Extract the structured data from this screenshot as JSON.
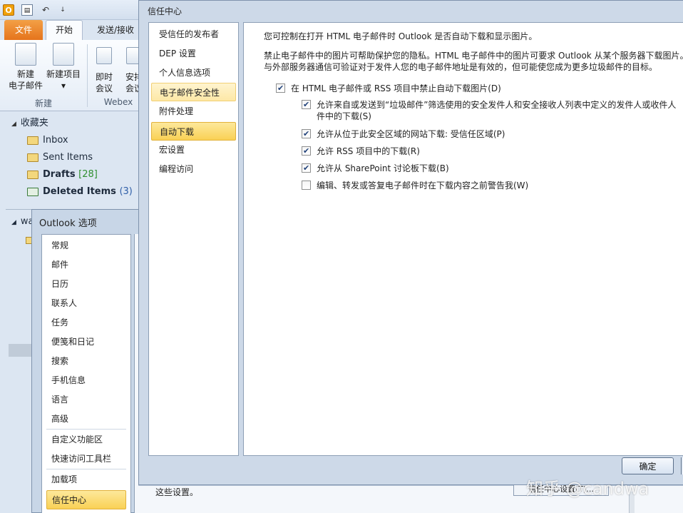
{
  "outlook": {
    "qat": {
      "logo_letter": "O",
      "dropdown_glyph": "↓"
    },
    "tabs": {
      "file": "文件",
      "home": "开始",
      "send_receive": "发送/接收"
    },
    "ribbon": {
      "new_email": [
        "新建",
        "电子邮件"
      ],
      "new_item": [
        "新建项目",
        "▾"
      ],
      "instant_meeting": [
        "即时",
        "会议"
      ],
      "arrange_meeting": [
        "安排",
        "会议"
      ],
      "group_new": "新建",
      "group_webex": "Webex"
    },
    "nav": {
      "favorites": "收藏夹",
      "inbox": "Inbox",
      "sent": "Sent Items",
      "drafts": "Drafts",
      "drafts_count": "[28]",
      "deleted": "Deleted Items",
      "deleted_count": "(3)",
      "account": "wa"
    }
  },
  "options_dialog": {
    "title": "Outlook 选项",
    "items": [
      "常规",
      "邮件",
      "日历",
      "联系人",
      "任务",
      "便笺和日记",
      "搜索",
      "手机信息",
      "语言",
      "高级",
      "自定义功能区",
      "快速访问工具栏",
      "加载项",
      "信任中心"
    ]
  },
  "trust_center": {
    "title": "信任中心",
    "sidebar": [
      "受信任的发布者",
      "DEP 设置",
      "个人信息选项",
      "电子邮件安全性",
      "附件处理",
      "自动下载",
      "宏设置",
      "编程访问"
    ],
    "intro": "您可控制在打开 HTML 电子邮件时 Outlook 是否自动下载和显示图片。",
    "privacy_line1": "禁止电子邮件中的图片可帮助保护您的隐私。HTML 电子邮件中的图片可要求 Outlook 从某个服务器下载图片。",
    "privacy_line2": "与外部服务器通信可验证对于发件人您的电子邮件地址是有效的，但可能使您成为更多垃圾邮件的目标。",
    "options": {
      "block_images": {
        "label": "在 HTML 电子邮件或 RSS 项目中禁止自动下载图片(D)",
        "checked": true
      },
      "allow_safe_senders_line1": "允许来自或发送到“垃圾邮件”筛选使用的安全发件人和安全接收人列表中定义的发件人或收件人",
      "allow_safe_senders_line2": "件中的下载(S)",
      "allow_safe_senders_checked": true,
      "allow_zone": {
        "label": "允许从位于此安全区域的网站下载: 受信任区域(P)",
        "checked": true
      },
      "allow_rss": {
        "label": "允许 RSS 项目中的下载(R)",
        "checked": true
      },
      "allow_sharepoint": {
        "label": "允许从 SharePoint 讨论板下载(B)",
        "checked": true
      },
      "warn_before_download": {
        "label": "编辑、转发或答复电子邮件时在下载内容之前警告我(W)",
        "checked": false
      }
    },
    "ok_button": "确定"
  },
  "background": {
    "bottom_text": "这些设置。",
    "trust_settings_button": "信任中心设置(T)..."
  },
  "watermark": "知乎 @candwa"
}
